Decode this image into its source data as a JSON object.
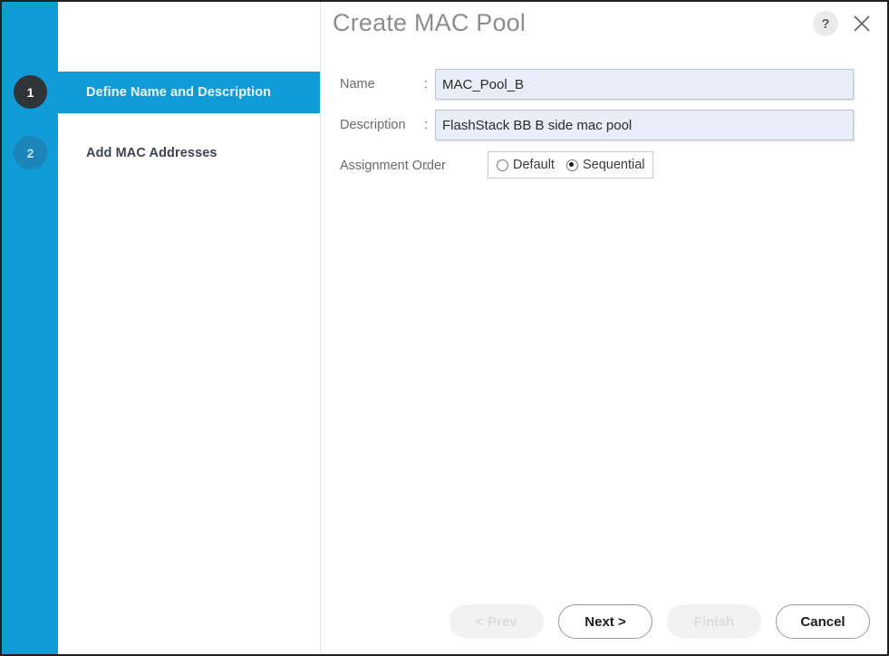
{
  "dialog": {
    "title": "Create MAC Pool",
    "help_icon": "help-icon",
    "help_label": "?",
    "close_icon": "close-icon"
  },
  "wizard": {
    "steps": [
      {
        "number": "1",
        "label": "Define Name and Description",
        "active": true
      },
      {
        "number": "2",
        "label": "Add MAC Addresses",
        "active": false
      }
    ]
  },
  "form": {
    "name": {
      "label": "Name",
      "colon": ":",
      "value": "MAC_Pool_B",
      "placeholder": ""
    },
    "description": {
      "label": "Description",
      "colon": ":",
      "value": "FlashStack BB B side mac pool",
      "placeholder": ""
    },
    "assignment_order": {
      "label": "Assignment Order",
      "colon": ":",
      "options": [
        {
          "label": "Default",
          "selected": false
        },
        {
          "label": "Sequential",
          "selected": true
        }
      ],
      "selected": "Sequential"
    }
  },
  "footer": {
    "buttons": [
      {
        "label": "< Prev",
        "enabled": false
      },
      {
        "label": "Next >",
        "enabled": true
      },
      {
        "label": "Finish",
        "enabled": false
      },
      {
        "label": "Cancel",
        "enabled": true
      }
    ]
  },
  "colors": {
    "accent_blue": "#109bd7",
    "step_active_bubble": "#2f3438",
    "step_inactive_bubble": "#1b84b8",
    "input_fill": "#e7eef7",
    "title_text": "#8d8d8d"
  }
}
